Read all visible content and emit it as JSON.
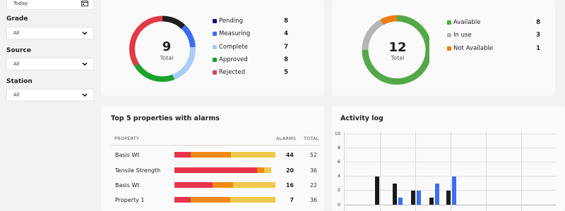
{
  "filters": {
    "date": {
      "value": "Today",
      "icon": "calendar-icon"
    },
    "grade": {
      "label": "Grade",
      "value": "All"
    },
    "source": {
      "label": "Source",
      "value": "All"
    },
    "station": {
      "label": "Station",
      "value": "All"
    }
  },
  "status_card": {
    "center_value": "9",
    "center_label": "Total",
    "items": [
      {
        "label": "Pending",
        "count": "8",
        "color": "#0a0a7a"
      },
      {
        "label": "Measuring",
        "count": "4",
        "color": "#3a6ef0"
      },
      {
        "label": "Complete",
        "count": "7",
        "color": "#a9cdf7"
      },
      {
        "label": "Approved",
        "count": "8",
        "color": "#1aa32a"
      },
      {
        "label": "Rejected",
        "count": "5",
        "color": "#e23a46"
      }
    ],
    "ring_segments": [
      {
        "color": "#1f1f1f",
        "fraction": 0.12
      },
      {
        "color": "#3a6ef0",
        "fraction": 0.12
      },
      {
        "color": "#a9cdf7",
        "fraction": 0.2
      },
      {
        "color": "#1aa32a",
        "fraction": 0.22
      },
      {
        "color": "#e23a46",
        "fraction": 0.34
      }
    ]
  },
  "availability_card": {
    "center_value": "12",
    "center_label": "Total",
    "items": [
      {
        "label": "Available",
        "count": "8",
        "color": "#54a848"
      },
      {
        "label": "In use",
        "count": "3",
        "color": "#b5b5b5"
      },
      {
        "label": "Not Available",
        "count": "1",
        "color": "#f07d14"
      }
    ],
    "ring_segments": [
      {
        "color": "#54a848",
        "fraction": 0.75
      },
      {
        "color": "#b5b5b5",
        "fraction": 0.17
      },
      {
        "color": "#f07d14",
        "fraction": 0.08
      }
    ]
  },
  "alarms_card": {
    "title": "Top 5 properties with alarms",
    "col_property": "PROPERTY",
    "col_alarms": "ALARMS",
    "col_total": "TOTAL",
    "colors": [
      "#e8344a",
      "#f08a14",
      "#f0c84a"
    ],
    "rows": [
      {
        "name": "Basis Wt",
        "alarms": "44",
        "total": "52",
        "segments": [
          0.16,
          0.4,
          0.44
        ]
      },
      {
        "name": "Tensile Strength",
        "alarms": "20",
        "total": "36",
        "segments": [
          0.82,
          0.07,
          0.07
        ]
      },
      {
        "name": "Basis Wt",
        "alarms": "16",
        "total": "22",
        "segments": [
          0.38,
          0.2,
          0.42
        ]
      },
      {
        "name": "Property 1",
        "alarms": "7",
        "total": "36",
        "segments": [
          0.16,
          0.39,
          0.45
        ]
      }
    ]
  },
  "activity_card": {
    "title": "Activity log",
    "y_ticks": [
      "10",
      "8",
      "6",
      "4",
      "2",
      "0"
    ],
    "ylim": [
      0,
      10
    ],
    "series_colors": [
      "#1a1a1a",
      "#3a6ef0"
    ],
    "groups": [
      {
        "dark": 4,
        "blue": 0
      },
      {
        "dark": 3,
        "blue": 1
      },
      {
        "dark": 2,
        "blue": 2
      },
      {
        "dark": 1,
        "blue": 3
      },
      {
        "dark": 2,
        "blue": 4
      }
    ]
  }
}
